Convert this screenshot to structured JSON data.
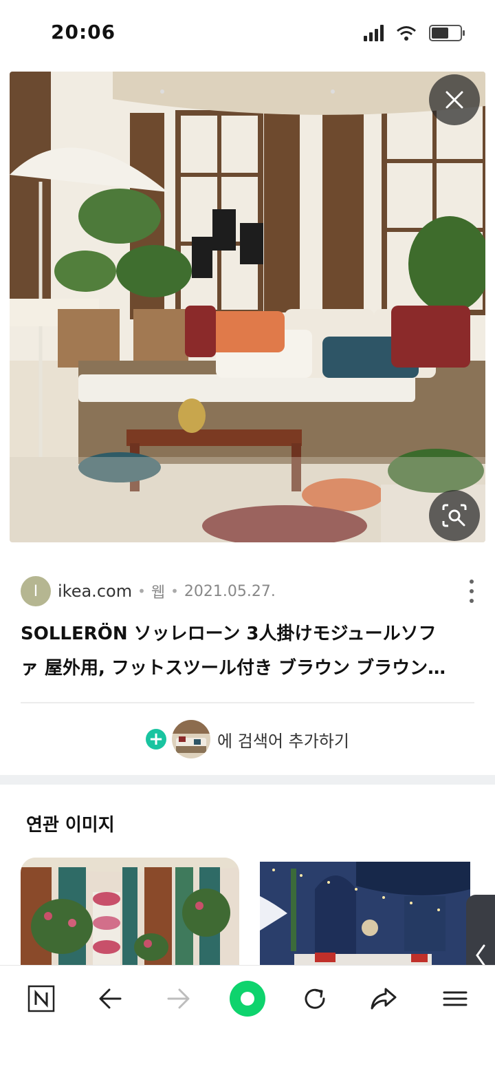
{
  "status_bar": {
    "time": "20:06",
    "battery_percent": 60
  },
  "viewer": {
    "close_icon": "close-icon",
    "lens_icon": "image-search-icon"
  },
  "result": {
    "source_initial": "I",
    "source_domain": "ikea.com",
    "source_type": "웹",
    "date": "2021.05.27.",
    "title_line1": "SOLLERÖN ソッレローン 3人掛けモジュールソフ",
    "title_line2": "ァ 屋外用, フットスツール付き ブラウン ブラウン…"
  },
  "add_search": {
    "label": "에 검색어 추가하기"
  },
  "related": {
    "title": "연관 이미지"
  },
  "bottom_nav": {
    "items": [
      "naver-home-icon",
      "back-arrow-icon",
      "forward-arrow-icon",
      "green-dot-icon",
      "refresh-icon",
      "share-icon",
      "menu-icon"
    ]
  },
  "colors": {
    "accent_green": "#0ed36d",
    "add_green": "#19c4a0"
  }
}
